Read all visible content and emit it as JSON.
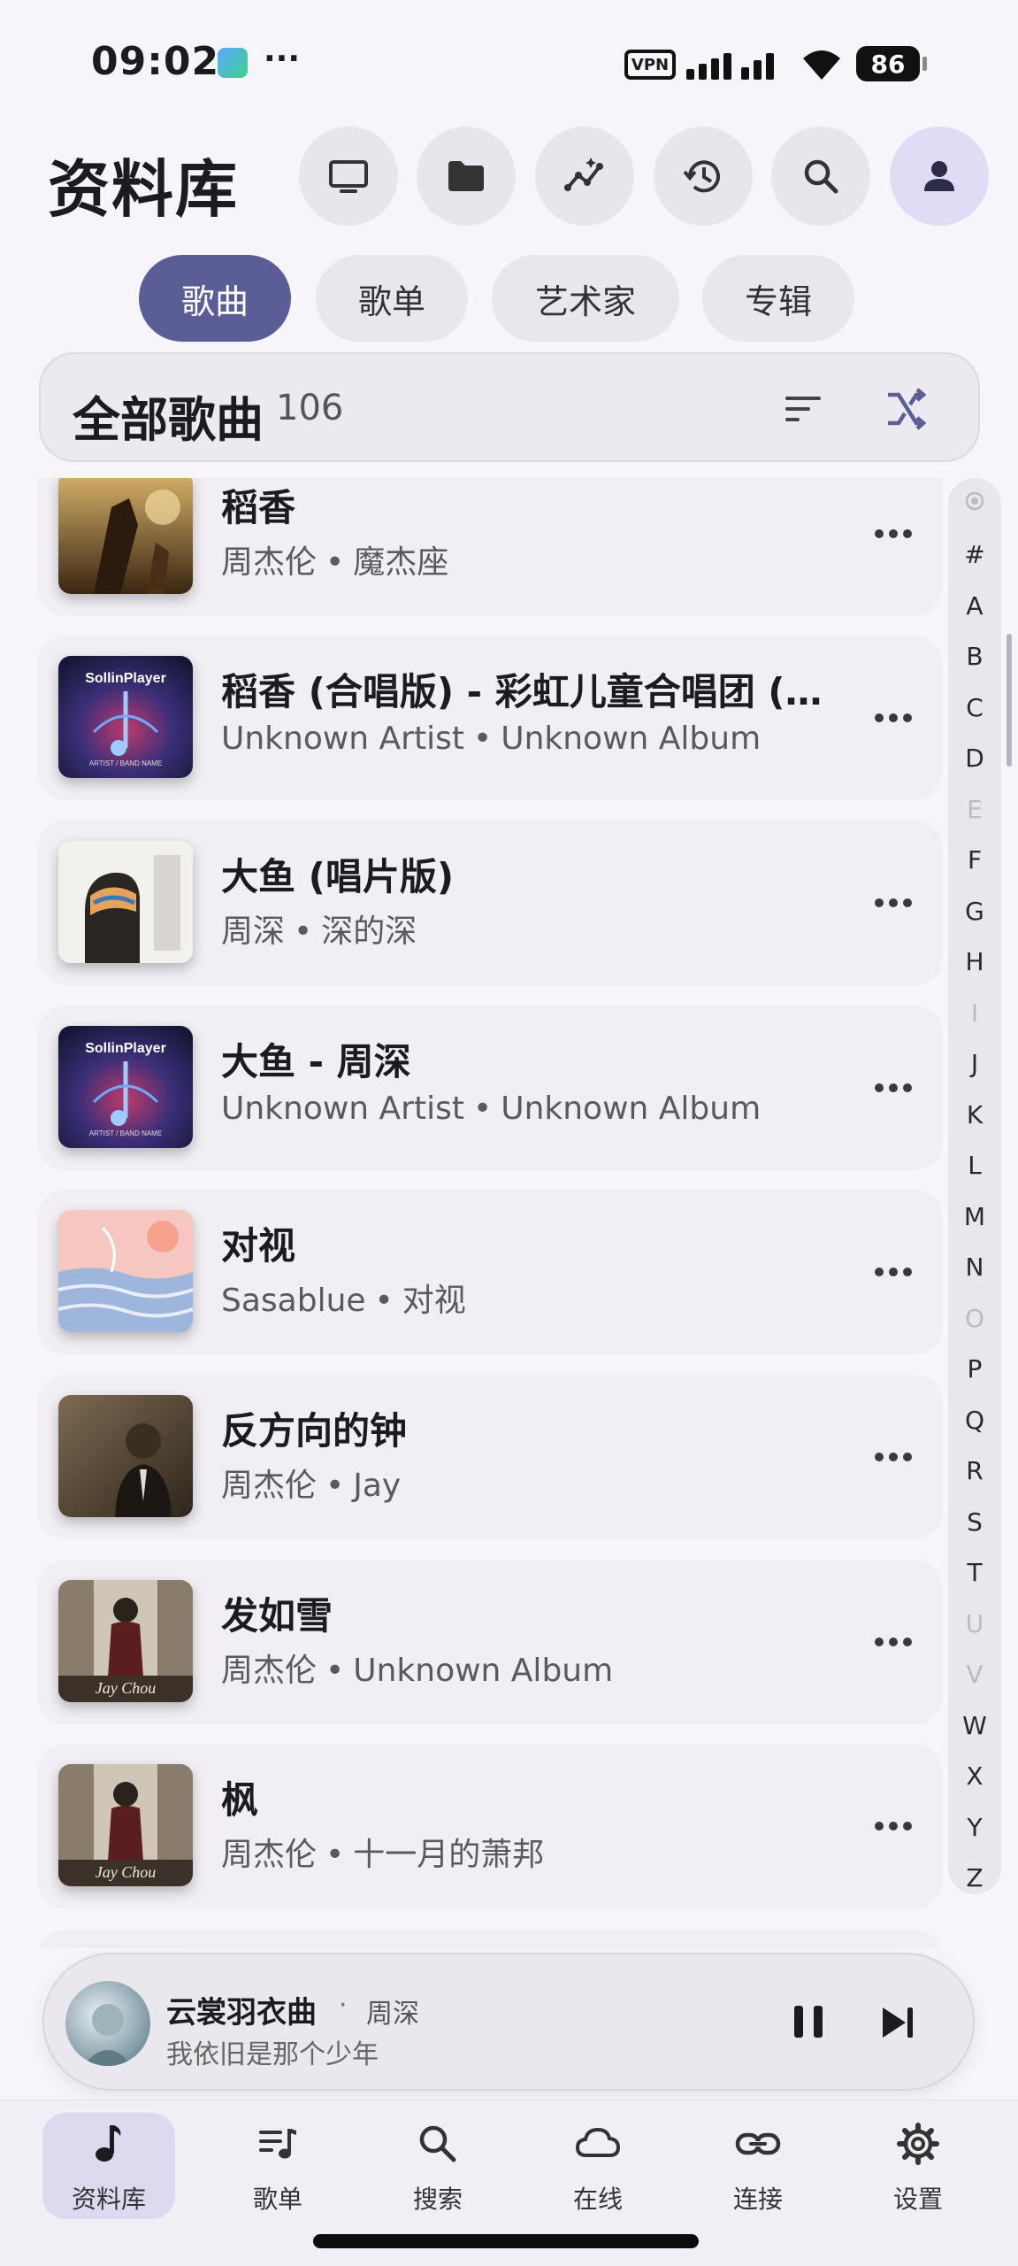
{
  "status_bar": {
    "time": "09:02",
    "more_indicator": "···",
    "vpn_label": "VPN",
    "battery": "86"
  },
  "header": {
    "title": "资料库",
    "actions": [
      "tv-icon",
      "folder-icon",
      "insights-icon",
      "history-icon",
      "search-icon",
      "profile-icon"
    ]
  },
  "tabs": [
    {
      "label": "歌曲",
      "active": true
    },
    {
      "label": "歌单",
      "active": false
    },
    {
      "label": "艺术家",
      "active": false
    },
    {
      "label": "专辑",
      "active": false
    }
  ],
  "all_songs": {
    "label": "全部歌曲",
    "count": "106"
  },
  "songs": [
    {
      "title": "稻香",
      "artist": "周杰伦",
      "album": "魔杰座"
    },
    {
      "title": "稻香 (合唱版) - 彩虹儿童合唱团 (…",
      "artist": "Unknown Artist",
      "album": "Unknown Album"
    },
    {
      "title": "大鱼 (唱片版)",
      "artist": "周深",
      "album": "深的深"
    },
    {
      "title": "大鱼 - 周深",
      "artist": "Unknown Artist",
      "album": "Unknown Album"
    },
    {
      "title": "对视",
      "artist": "Sasablue",
      "album": "对视"
    },
    {
      "title": "反方向的钟",
      "artist": "周杰伦",
      "album": "Jay"
    },
    {
      "title": "发如雪",
      "artist": "周杰伦",
      "album": "Unknown Album"
    },
    {
      "title": "枫",
      "artist": "周杰伦",
      "album": "十一月的萧邦"
    }
  ],
  "cover_text": {
    "sollin_brand": "SollinPlayer",
    "sollin_sub": "ARTIST / BAND NAME",
    "jay_sign": "Jay Chou"
  },
  "separator": "•",
  "alphabet": [
    "#",
    "A",
    "B",
    "C",
    "D",
    "E",
    "F",
    "G",
    "H",
    "I",
    "J",
    "K",
    "L",
    "M",
    "N",
    "O",
    "P",
    "Q",
    "R",
    "S",
    "T",
    "U",
    "V",
    "W",
    "X",
    "Y",
    "Z"
  ],
  "alphabet_dim": [
    "E",
    "I",
    "O",
    "U",
    "V"
  ],
  "now_playing": {
    "title": "云裳羽衣曲",
    "separator": "·",
    "artist": "周深",
    "lyric": "我依旧是那个少年"
  },
  "bottom_nav": [
    {
      "label": "资料库",
      "icon": "music-note-icon",
      "active": true
    },
    {
      "label": "歌单",
      "icon": "playlist-icon",
      "active": false
    },
    {
      "label": "搜索",
      "icon": "search-icon",
      "active": false
    },
    {
      "label": "在线",
      "icon": "cloud-icon",
      "active": false
    },
    {
      "label": "连接",
      "icon": "link-icon",
      "active": false
    },
    {
      "label": "设置",
      "icon": "settings-icon",
      "active": false
    }
  ],
  "colors": {
    "accent": "#5b5d97",
    "background": "#f7f4fa"
  }
}
